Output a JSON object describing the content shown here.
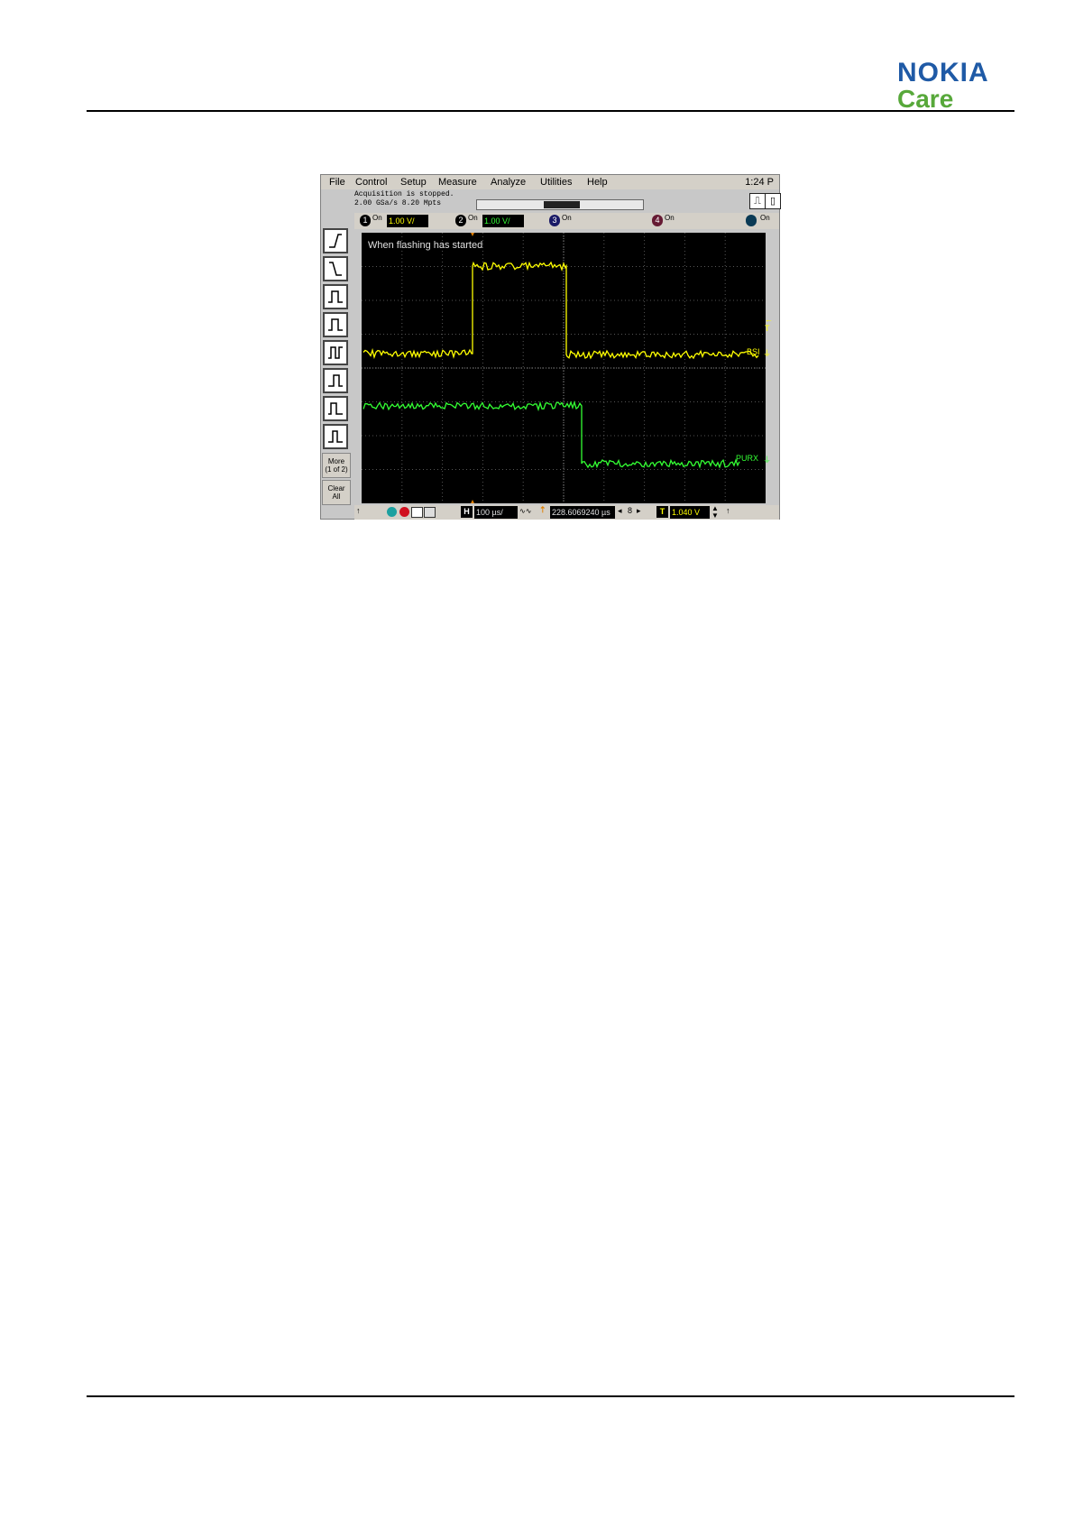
{
  "brand": {
    "line1": "NOKIA",
    "line2": "Care",
    "color_blue": "#1f5aa6",
    "color_green": "#57a83a"
  },
  "scope": {
    "menu": [
      "File",
      "Control",
      "Setup",
      "Measure",
      "Analyze",
      "Utilities",
      "Help"
    ],
    "time": "1:24 P",
    "status_line1": "Acquisition is stopped.",
    "status_line2": "2.00 GSa/s   8.20 Mpts",
    "channels": [
      {
        "num": "1",
        "on": "On",
        "scale": "1.00 V/",
        "color": "#ffff00"
      },
      {
        "num": "2",
        "on": "On",
        "scale": "1.00 V/",
        "color": "#33ff33"
      },
      {
        "num": "3",
        "on": "On"
      },
      {
        "num": "4",
        "on": "On"
      },
      {
        "num": "",
        "on": "On"
      }
    ],
    "annotation": "When flashing has started",
    "labels": {
      "trigger": "T",
      "ch1": "BSI",
      "ch2": "PURX"
    },
    "tools": {
      "more": "More",
      "more_sub": "(1 of 2)",
      "clear": "Clear",
      "clear_sub": "All"
    },
    "bottom": {
      "h_label": "H",
      "timebase": "100 µs/",
      "delay": "228.6069240 µs",
      "nav": "8",
      "t_label": "T",
      "trigger_level": "1.040 V"
    }
  }
}
